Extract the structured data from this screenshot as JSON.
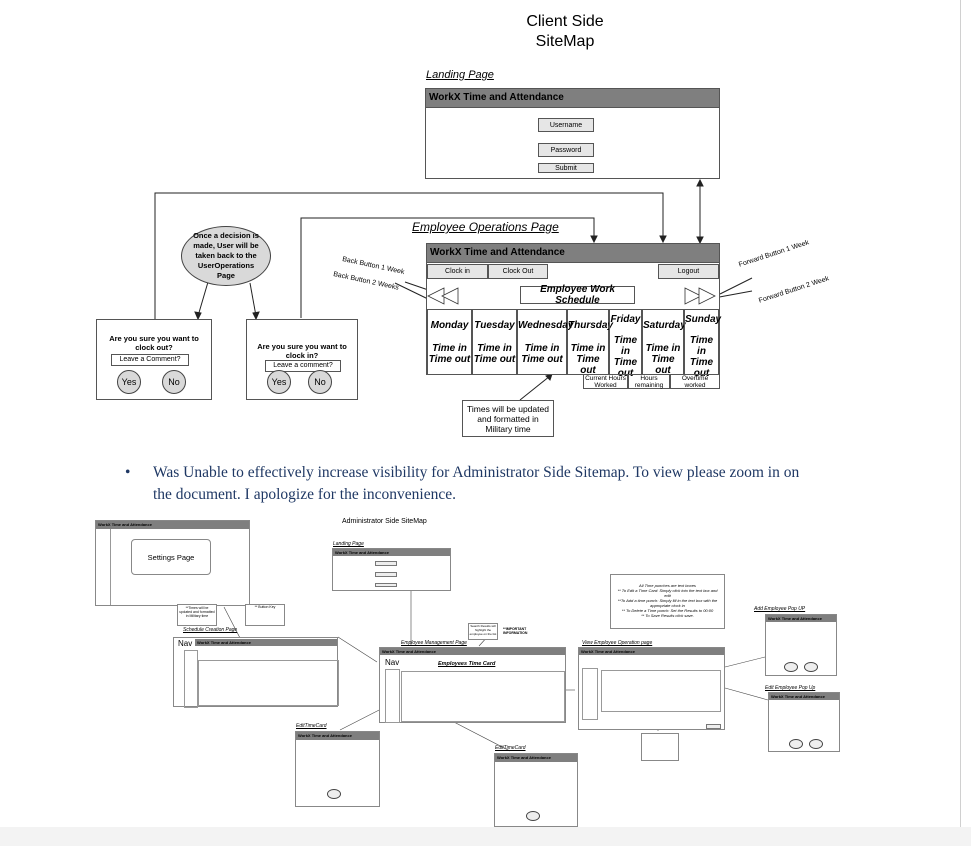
{
  "title_line1": "Client Side",
  "title_line2": "SiteMap",
  "landing": {
    "label": "Landing Page",
    "header": "WorkX Time and Attendance",
    "username": "Username",
    "password": "Password",
    "submit": "Submit"
  },
  "ops": {
    "label": "Employee Operations Page",
    "header": "WorkX Time and Attendance",
    "clock_in": "Clock in",
    "clock_out": "Clock Out",
    "logout": "Logout",
    "schedule_title": "Employee Work Schedule",
    "back1": "Back Button 1 Week",
    "back2": "Back Button 2 Weeks",
    "fwd1": "Forward Button 1 Week",
    "fwd2": "Forward Button 2 Week",
    "days": [
      {
        "name": "Monday",
        "times": "Time in\nTime out"
      },
      {
        "name": "Tuesday",
        "times": "Time in\nTime out"
      },
      {
        "name": "Wednesday",
        "times": "Time in\nTime out"
      },
      {
        "name": "Thursday",
        "times": "Time in\nTime out"
      },
      {
        "name": "Friday",
        "times": "Time in\nTime\nout"
      },
      {
        "name": "Saturday",
        "times": "Time in\nTime out"
      },
      {
        "name": "Sunday",
        "times": "Time in\nTime\nout"
      }
    ],
    "stats": [
      "Current Hours\nWorked",
      "Hours\nremaining",
      "Overtime\nworked"
    ],
    "note": "Times will be updated and formatted in Military time"
  },
  "decision_note": "Once a decision is made, User will be taken back to the UserOperations Page",
  "clockout_dialog": {
    "question": "Are you sure you want to clock out?",
    "comment": "Leave a Comment?",
    "yes": "Yes",
    "no": "No"
  },
  "clockin_dialog": {
    "question": "Are you sure you want to clock in?",
    "comment": "Leave a comment?",
    "yes": "Yes",
    "no": "No"
  },
  "bullet": "Was Unable to effectively increase visibility for Administrator Side Sitemap. To view please zoom in on the document. I apologize for the inconvenience.",
  "admin": {
    "title": "Administrator Side SiteMap",
    "header": "WorkX Time and Attendance",
    "settings": "Settings Page",
    "landing_label": "Landing Page",
    "schedule_label": "Schedule Creation Page",
    "emp_mgmt_label": "Employee Management Page",
    "employees_tc": "Employees Time Card",
    "view_emp_label": "View Employee Operation page",
    "add_emp_label": "Add Employee Pop UP",
    "edit_emp_label": "Edit Employee Pop Up",
    "edit_tc_label": "EditTimeCard",
    "nav": "Nav",
    "times_note": "**Times will be updated and formatted in Military time",
    "button_key": "** Button Key",
    "search_note": "Search Results will highlight the employee on the list",
    "important": "**IMPORTANT INFORMATION",
    "punch_note": "All Time punches are text boxes\n** To Edit a Time Card: Simply click into the text box and edit\n**To Add a time punch: Simply fill in the text box with the appropriate clock in\n** To Delete a Time punch: Set the Results to 00:00\n** To Save Results click save."
  }
}
